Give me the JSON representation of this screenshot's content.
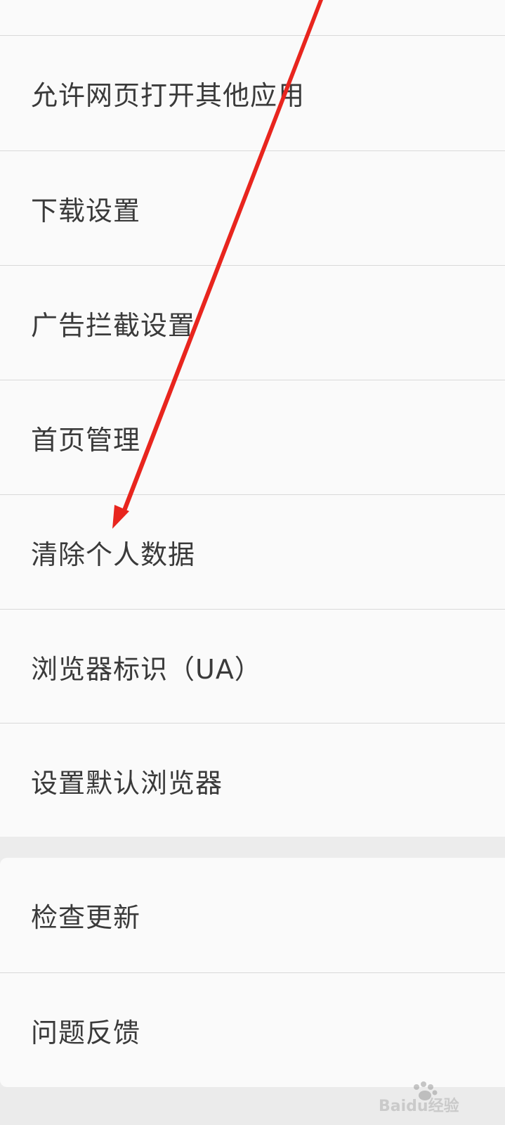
{
  "settings": {
    "items": [
      {
        "label": "允许网页打开其他应用"
      },
      {
        "label": "下载设置"
      },
      {
        "label": "广告拦截设置"
      },
      {
        "label": "首页管理"
      },
      {
        "label": "清除个人数据"
      },
      {
        "label": "浏览器标识（UA）"
      },
      {
        "label": "设置默认浏览器"
      }
    ],
    "items_secondary": [
      {
        "label": "检查更新"
      },
      {
        "label": "问题反馈"
      }
    ]
  },
  "annotation": {
    "arrow_color": "#e8251e"
  },
  "watermark": {
    "text": "Baidu经验"
  }
}
